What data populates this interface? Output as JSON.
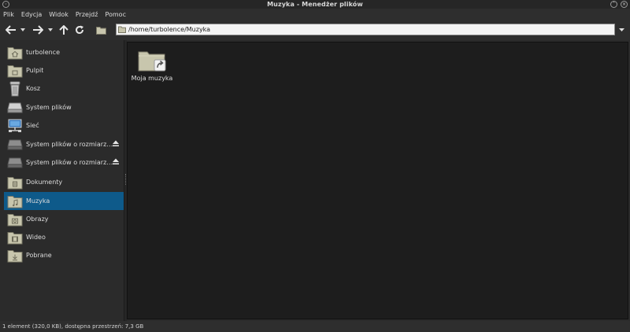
{
  "window": {
    "title": "Muzyka - Menedżer plików"
  },
  "menubar": {
    "items": [
      {
        "label": "Plik"
      },
      {
        "label": "Edycja"
      },
      {
        "label": "Widok"
      },
      {
        "label": "Przejdź"
      },
      {
        "label": "Pomoc"
      }
    ]
  },
  "location": {
    "path": "/home/turbolence/Muzyka"
  },
  "sidebar": {
    "items": [
      {
        "label": "turbolence",
        "icon": "home-folder-icon"
      },
      {
        "label": "Pulpit",
        "icon": "desktop-folder-icon"
      },
      {
        "label": "Kosz",
        "icon": "trash-icon"
      },
      {
        "label": "System plików",
        "icon": "filesystem-drive-icon"
      },
      {
        "label": "Sieć",
        "icon": "network-icon"
      },
      {
        "label": "System plików o rozmiarz…",
        "icon": "drive-icon"
      },
      {
        "label": "System plików o rozmiarz…",
        "icon": "drive-icon"
      },
      {
        "label": "Dokumenty",
        "icon": "documents-folder-icon"
      },
      {
        "label": "Muzyka",
        "icon": "music-folder-icon",
        "active": true
      },
      {
        "label": "Obrazy",
        "icon": "pictures-folder-icon"
      },
      {
        "label": "Wideo",
        "icon": "videos-folder-icon"
      },
      {
        "label": "Pobrane",
        "icon": "downloads-folder-icon"
      }
    ]
  },
  "files": [
    {
      "name": "Moja muzyka",
      "icon": "folder-link-icon"
    }
  ],
  "status": {
    "text": "1 element (320,0 KB), dostępna przestrzeń: 7,3 GB"
  },
  "colors": {
    "selection": "#0e5a8a",
    "folder": "#c8c6ad",
    "background": "#1d1d1d"
  }
}
